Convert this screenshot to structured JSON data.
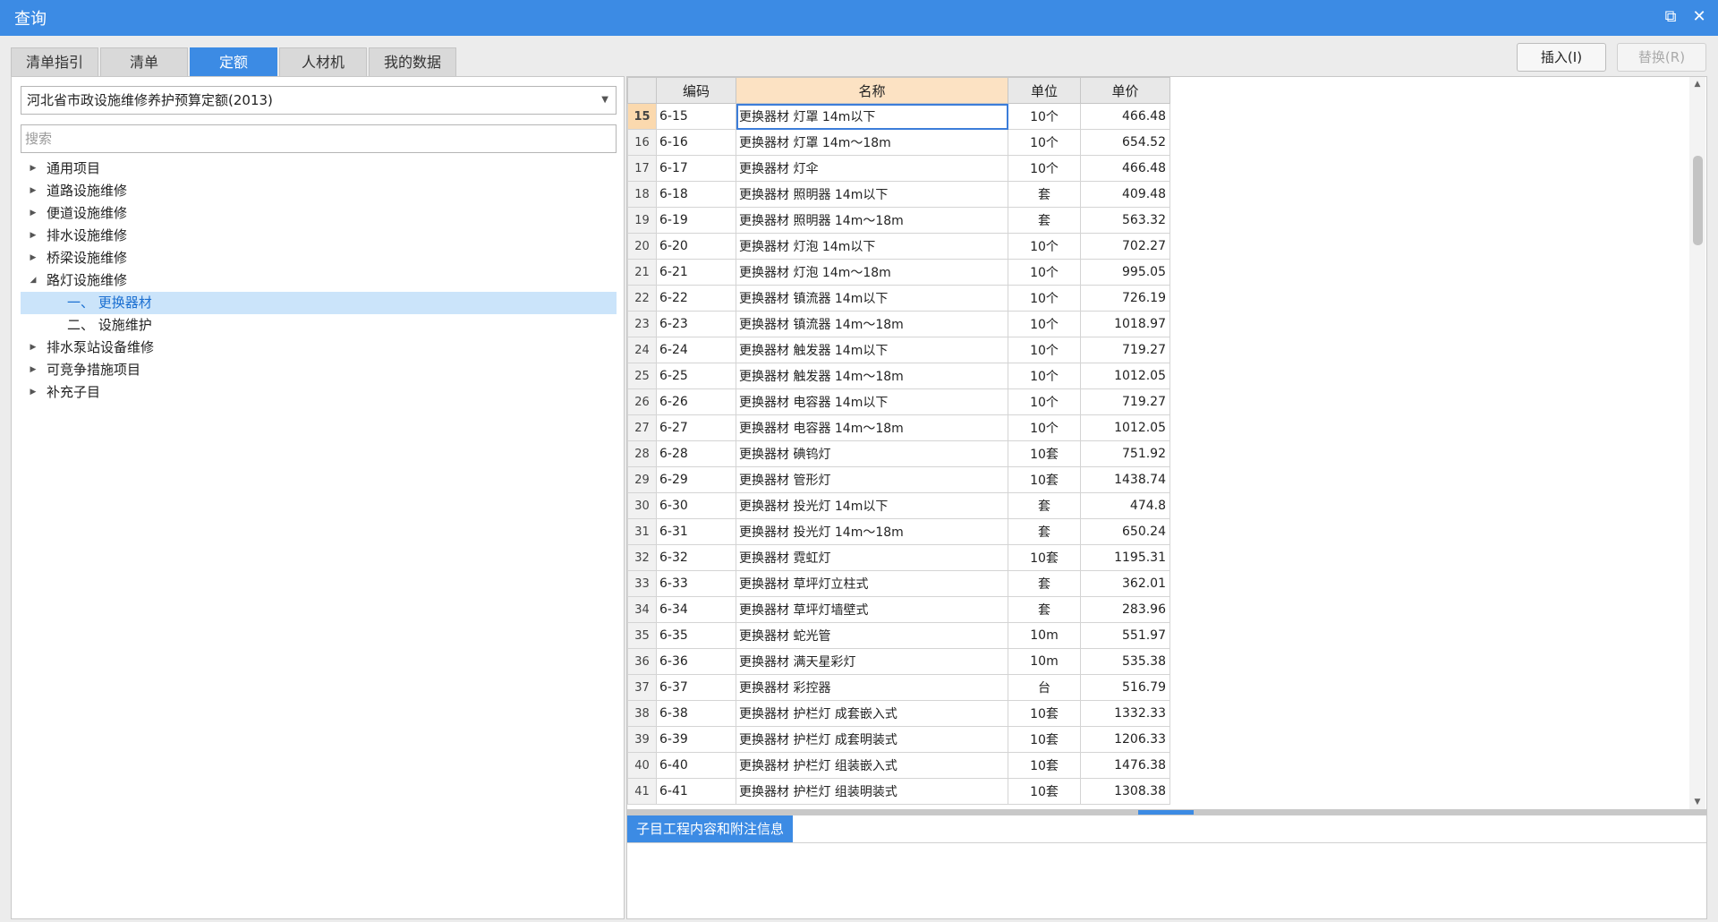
{
  "window": {
    "title": "查询"
  },
  "tabs": [
    "清单指引",
    "清单",
    "定额",
    "人材机",
    "我的数据"
  ],
  "active_tab": "定额",
  "actions": {
    "insert": "插入(I)",
    "replace": "替换(R)"
  },
  "library": {
    "selected": "河北省市政设施维修养护预算定额(2013)"
  },
  "search": {
    "placeholder": "搜索"
  },
  "tree": [
    {
      "label": "通用项目",
      "expanded": false
    },
    {
      "label": "道路设施维修",
      "expanded": false
    },
    {
      "label": "便道设施维修",
      "expanded": false
    },
    {
      "label": "排水设施维修",
      "expanded": false
    },
    {
      "label": "桥梁设施维修",
      "expanded": false
    },
    {
      "label": "路灯设施维修",
      "expanded": true
    },
    {
      "label": "一、 更换器材",
      "child": true,
      "selected": true
    },
    {
      "label": "二、 设施维护",
      "child": true
    },
    {
      "label": "排水泵站设备维修",
      "expanded": false
    },
    {
      "label": "可竞争措施项目",
      "expanded": false
    },
    {
      "label": "补充子目",
      "expanded": false
    }
  ],
  "grid": {
    "headers": {
      "code": "编码",
      "name": "名称",
      "unit": "单位",
      "price": "单价"
    },
    "rows": [
      [
        "15",
        "6-15",
        "更换器材 灯罩 14m以下",
        "10个",
        "466.48"
      ],
      [
        "16",
        "6-16",
        "更换器材 灯罩 14m～18m",
        "10个",
        "654.52"
      ],
      [
        "17",
        "6-17",
        "更换器材 灯伞",
        "10个",
        "466.48"
      ],
      [
        "18",
        "6-18",
        "更换器材 照明器 14m以下",
        "套",
        "409.48"
      ],
      [
        "19",
        "6-19",
        "更换器材 照明器 14m～18m",
        "套",
        "563.32"
      ],
      [
        "20",
        "6-20",
        "更换器材 灯泡 14m以下",
        "10个",
        "702.27"
      ],
      [
        "21",
        "6-21",
        "更换器材 灯泡 14m～18m",
        "10个",
        "995.05"
      ],
      [
        "22",
        "6-22",
        "更换器材 镇流器 14m以下",
        "10个",
        "726.19"
      ],
      [
        "23",
        "6-23",
        "更换器材 镇流器 14m～18m",
        "10个",
        "1018.97"
      ],
      [
        "24",
        "6-24",
        "更换器材 触发器 14m以下",
        "10个",
        "719.27"
      ],
      [
        "25",
        "6-25",
        "更换器材 触发器 14m～18m",
        "10个",
        "1012.05"
      ],
      [
        "26",
        "6-26",
        "更换器材 电容器 14m以下",
        "10个",
        "719.27"
      ],
      [
        "27",
        "6-27",
        "更换器材 电容器 14m～18m",
        "10个",
        "1012.05"
      ],
      [
        "28",
        "6-28",
        "更换器材 碘钨灯",
        "10套",
        "751.92"
      ],
      [
        "29",
        "6-29",
        "更换器材 管形灯",
        "10套",
        "1438.74"
      ],
      [
        "30",
        "6-30",
        "更换器材 投光灯 14m以下",
        "套",
        "474.8"
      ],
      [
        "31",
        "6-31",
        "更换器材 投光灯 14m～18m",
        "套",
        "650.24"
      ],
      [
        "32",
        "6-32",
        "更换器材 霓虹灯",
        "10套",
        "1195.31"
      ],
      [
        "33",
        "6-33",
        "更换器材 草坪灯立柱式",
        "套",
        "362.01"
      ],
      [
        "34",
        "6-34",
        "更换器材 草坪灯墙壁式",
        "套",
        "283.96"
      ],
      [
        "35",
        "6-35",
        "更换器材 蛇光管",
        "10m",
        "551.97"
      ],
      [
        "36",
        "6-36",
        "更换器材 满天星彩灯",
        "10m",
        "535.38"
      ],
      [
        "37",
        "6-37",
        "更换器材 彩控器",
        "台",
        "516.79"
      ],
      [
        "38",
        "6-38",
        "更换器材 护栏灯 成套嵌入式",
        "10套",
        "1332.33"
      ],
      [
        "39",
        "6-39",
        "更换器材 护栏灯 成套明装式",
        "10套",
        "1206.33"
      ],
      [
        "40",
        "6-40",
        "更换器材 护栏灯 组装嵌入式",
        "10套",
        "1476.38"
      ],
      [
        "41",
        "6-41",
        "更换器材 护栏灯 组装明装式",
        "10套",
        "1308.38"
      ]
    ]
  },
  "bottom": {
    "tab_label": "子目工程内容和附注信息"
  }
}
